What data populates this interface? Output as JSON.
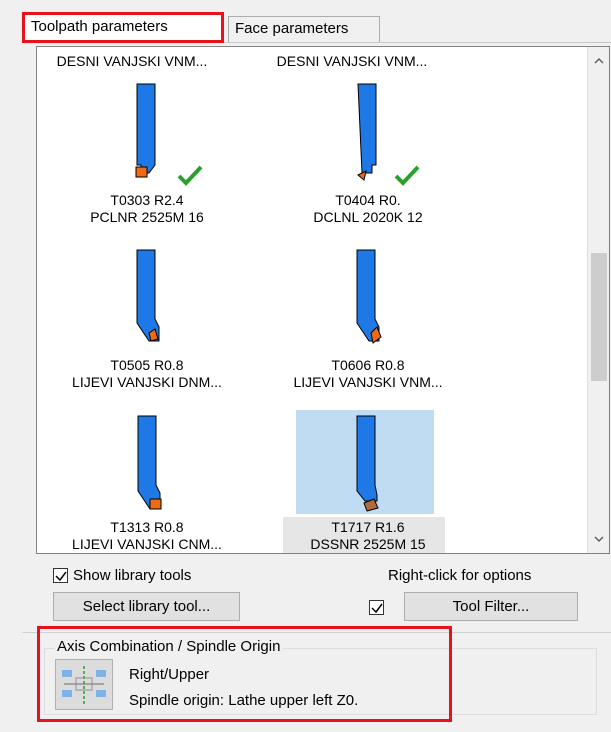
{
  "tabs": [
    {
      "label": "Toolpath parameters",
      "active": true
    },
    {
      "label": "Face parameters",
      "active": false
    }
  ],
  "tool_list": {
    "top_row": [
      "DESNI VANJSKI VNM...",
      "DESNI VANJSKI VNM..."
    ],
    "tools": [
      {
        "line1": "T0303 R2.4",
        "line2": "PCLNR 2525M 16",
        "checked": true
      },
      {
        "line1": "T0404 R0.",
        "line2": "DCLNL 2020K 12",
        "checked": true
      },
      {
        "line1": "T0505 R0.8",
        "line2": "LIJEVI VANJSKI DNM...",
        "checked": false
      },
      {
        "line1": "T0606 R0.8",
        "line2": "LIJEVI VANJSKI VNM...",
        "checked": false
      },
      {
        "line1": "T1313 R0.8",
        "line2": "LIJEVI VANJSKI CNM...",
        "checked": false
      },
      {
        "line1": "T1717 R1.6",
        "line2": "DSSNR 2525M 15",
        "checked": false,
        "selected": true
      }
    ]
  },
  "options": {
    "show_library_label": "Show library tools",
    "show_library_checked": true,
    "hint": "Right-click for options",
    "select_library_button": "Select library tool...",
    "tool_filter_button": "Tool Filter...",
    "tool_filter_checked": true
  },
  "axis": {
    "group_title": "Axis Combination / Spindle Origin",
    "combination": "Right/Upper",
    "spindle_origin": "Spindle origin: Lathe upper left  Z0."
  },
  "colors": {
    "highlight_red": "#e8121d",
    "tool_blue": "#1e78e6",
    "insert_orange": "#f06a14",
    "check_green": "#2ca02c",
    "selection": "#bfdcf3"
  }
}
